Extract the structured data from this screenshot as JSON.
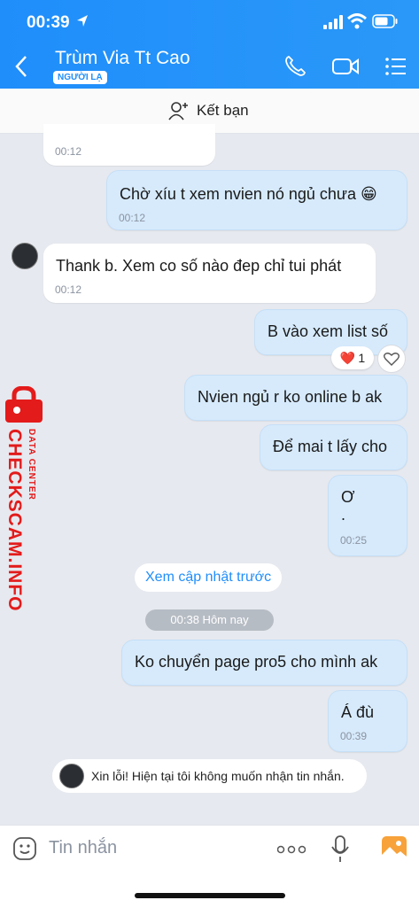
{
  "status_bar": {
    "time": "00:39"
  },
  "header": {
    "contact_name": "Trùm Via Tt Cao",
    "badge": "NGƯỜI LẠ"
  },
  "friend_bar": {
    "label": "Kết bạn"
  },
  "messages": [
    {
      "text": "",
      "time": "00:12"
    },
    {
      "text": "Chờ xíu t xem nvien nó ngủ chưa 😁",
      "time": "00:12"
    },
    {
      "text": "Thank b. Xem co số nào đep chỉ tui phát",
      "time": "00:12"
    },
    {
      "text": "B vào xem list số",
      "time": ""
    },
    {
      "text": "Nvien ngủ r ko online b ak",
      "time": ""
    },
    {
      "text": "Để mai t lấy cho",
      "time": ""
    },
    {
      "text": "Ơ",
      "text2": ".",
      "time": "00:25"
    },
    {
      "text": "Ko chuyển page pro5 cho mình ak",
      "time": ""
    },
    {
      "text": "Á đù",
      "time": "00:39"
    }
  ],
  "reaction": {
    "emoji": "❤️",
    "count": "1"
  },
  "load_more": "Xem cập nhật trước",
  "date_pill": "00:38 Hôm nay",
  "system_message": "Xin lỗi! Hiện tại tôi không muốn nhận tin nhắn.",
  "watermark": {
    "main": "CHECKSCAM.INFO",
    "sub": "DATA CENTER"
  },
  "input": {
    "placeholder": "Tin nhắn"
  },
  "colors": {
    "header_blue": "#1f8efb",
    "out_bubble": "#d6eafc",
    "watermark_red": "#e31b1b"
  }
}
